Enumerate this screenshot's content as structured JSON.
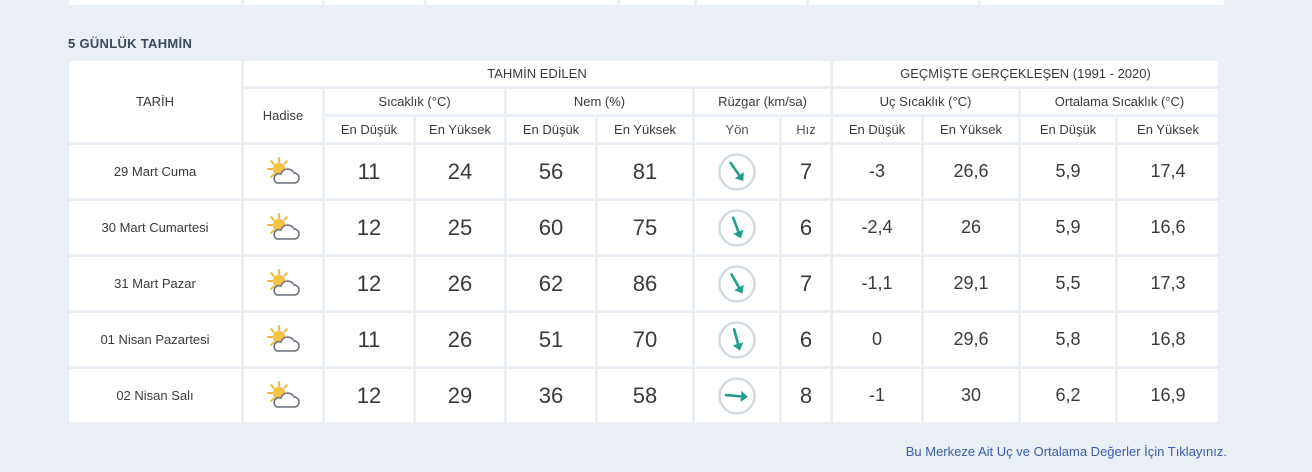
{
  "section_title": "5 GÜNLÜK TAHMİN",
  "headers": {
    "date": "TARİH",
    "forecast_group": "TAHMİN EDİLEN",
    "history_group": "GEÇMİŞTE GERÇEKLEŞEN (1991 - 2020)",
    "hadise": "Hadise",
    "temperature": "Sıcaklık (°C)",
    "humidity": "Nem (%)",
    "wind": "Rüzgar (km/sa)",
    "extreme_temp": "Uç Sıcaklık (°C)",
    "avg_temp": "Ortalama Sıcaklık (°C)",
    "low": "En Düşük",
    "high": "En Yüksek",
    "direction": "Yön",
    "speed": "Hız"
  },
  "colors": {
    "low": "#2e8fb5",
    "high": "#e0435a",
    "humidity_low": "#e49b2a",
    "humidity_high": "#7a6cab",
    "wind": "#2bb3a0",
    "link": "#3a5fa8"
  },
  "rows": [
    {
      "date": "29 Mart Cuma",
      "icon": "partly-cloudy-icon",
      "temp_low": "11",
      "temp_high": "24",
      "hum_low": "56",
      "hum_high": "81",
      "wind_dir_deg": 145,
      "wind_speed": "7",
      "ext_low": "-3",
      "ext_high": "26,6",
      "avg_low": "5,9",
      "avg_high": "17,4"
    },
    {
      "date": "30 Mart Cumartesi",
      "icon": "partly-cloudy-icon",
      "temp_low": "12",
      "temp_high": "25",
      "hum_low": "60",
      "hum_high": "75",
      "wind_dir_deg": 160,
      "wind_speed": "6",
      "ext_low": "-2,4",
      "ext_high": "26",
      "avg_low": "5,9",
      "avg_high": "16,6"
    },
    {
      "date": "31 Mart Pazar",
      "icon": "partly-cloudy-icon",
      "temp_low": "12",
      "temp_high": "26",
      "hum_low": "62",
      "hum_high": "86",
      "wind_dir_deg": 150,
      "wind_speed": "7",
      "ext_low": "-1,1",
      "ext_high": "29,1",
      "avg_low": "5,5",
      "avg_high": "17,3"
    },
    {
      "date": "01 Nisan Pazartesi",
      "icon": "partly-cloudy-icon",
      "temp_low": "11",
      "temp_high": "26",
      "hum_low": "51",
      "hum_high": "70",
      "wind_dir_deg": 165,
      "wind_speed": "6",
      "ext_low": "0",
      "ext_high": "29,6",
      "avg_low": "5,8",
      "avg_high": "16,8"
    },
    {
      "date": "02 Nisan Salı",
      "icon": "partly-cloudy-icon",
      "temp_low": "12",
      "temp_high": "29",
      "hum_low": "36",
      "hum_high": "58",
      "wind_dir_deg": 95,
      "wind_speed": "8",
      "ext_low": "-1",
      "ext_high": "30",
      "avg_low": "6,2",
      "avg_high": "16,9"
    }
  ],
  "footer_link": "Bu Merkeze Ait Uç ve Ortalama Değerler İçin Tıklayınız."
}
